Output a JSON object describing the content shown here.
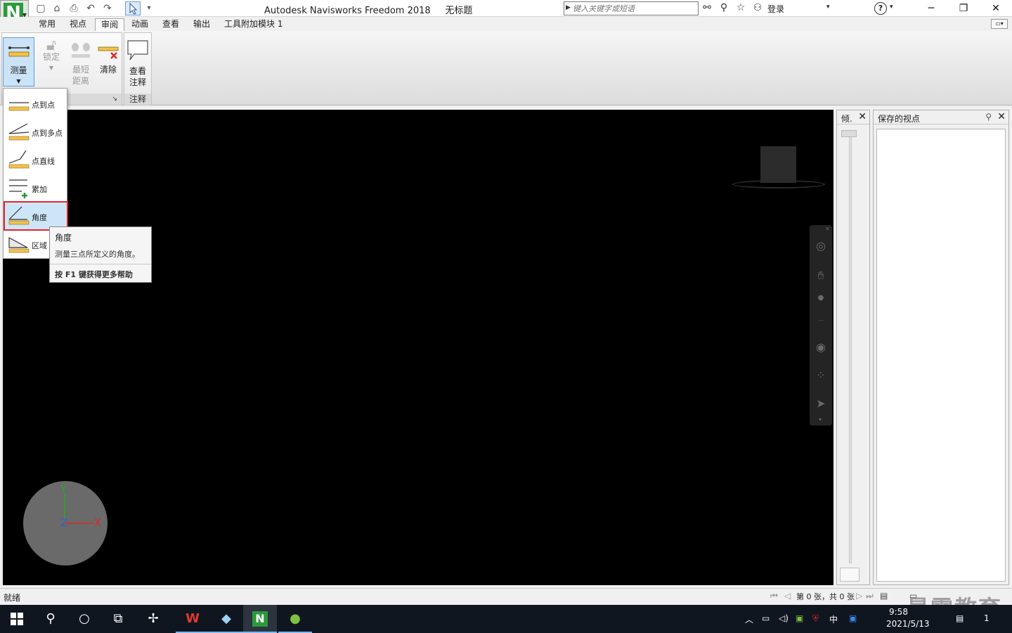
{
  "window": {
    "title": "Autodesk Navisworks Freedom 2018",
    "doc_title": "无标题",
    "app_letter": "N",
    "min_icon": "minimize-icon",
    "max_icon": "restore-icon",
    "close_icon": "close-icon"
  },
  "search": {
    "placeholder": "键入关键字或短语"
  },
  "account": {
    "login_label": "登录",
    "help": "?"
  },
  "tabs": [
    "常用",
    "视点",
    "审阅",
    "动画",
    "查看",
    "输出",
    "工具附加模块 1"
  ],
  "active_tab": "审阅",
  "ribbon": {
    "measure": "测量",
    "lock": "锁定",
    "shortest_1": "最短",
    "shortest_2": "距离",
    "clear": "清除",
    "view_1": "查看",
    "view_2": "注释",
    "panel_notes": "注释"
  },
  "dropdown": {
    "items": [
      "点到点",
      "点到多点",
      "点直线",
      "累加",
      "角度",
      "区域"
    ],
    "selected": "角度"
  },
  "tooltip": {
    "title": "角度",
    "description": "测量三点所定义的角度。",
    "help": "按 F1 键获得更多帮助"
  },
  "gizmo": {
    "x": "X",
    "y": "Y",
    "z": "Z"
  },
  "side_panels": {
    "tilt_title": "倾.",
    "views_title": "保存的视点"
  },
  "status": {
    "text": "就绪",
    "page_info": "第 0 张，共 0 张"
  },
  "taskbar": {
    "time": "9:58",
    "date": "2021/5/13",
    "ime": "中",
    "notification_count": "1"
  },
  "watermark": "最需教育",
  "colors": {
    "accent_blue": "#5f9bd8",
    "highlight_red": "#e0262d",
    "app_green": "#2a9a3a",
    "viewport_bg": "#000000"
  }
}
